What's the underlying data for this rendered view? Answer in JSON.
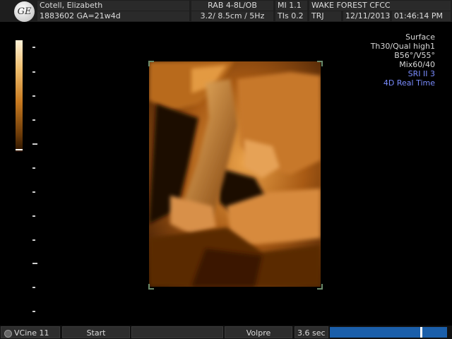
{
  "header": {
    "logo_text": "GE",
    "patient_name": "Cotell, Elizabeth",
    "patient_id": "1883602  GA=21w4d",
    "probe": "RAB 4-8L/OB",
    "depth_freq": "3.2/ 8.5cm / 5Hz",
    "mi": "MI  1.1",
    "tis": "TIs  0.2",
    "facility": "WAKE FOREST CFCC",
    "operator": "TRJ",
    "date": "12/11/2013",
    "time": "01:46:14 PM"
  },
  "settings": {
    "render_mode": "Surface",
    "threshold_quality": "Th30/Qual high1",
    "angles": "B56°/V55°",
    "mix": "Mix60/40",
    "sri": "SRI II 3",
    "mode": "4D Real Time"
  },
  "bottom_bar": {
    "vcine": "VCine 11",
    "start": "Start",
    "volpre": "Volpre",
    "duration": "3.6 sec",
    "cine_progress_fraction": 0.78
  },
  "colors": {
    "header_bg": "#1e1e1e",
    "blue_text": "#7a8cff",
    "progress_bar": "#1b5faa",
    "tint_sepia": "#c87a20"
  }
}
